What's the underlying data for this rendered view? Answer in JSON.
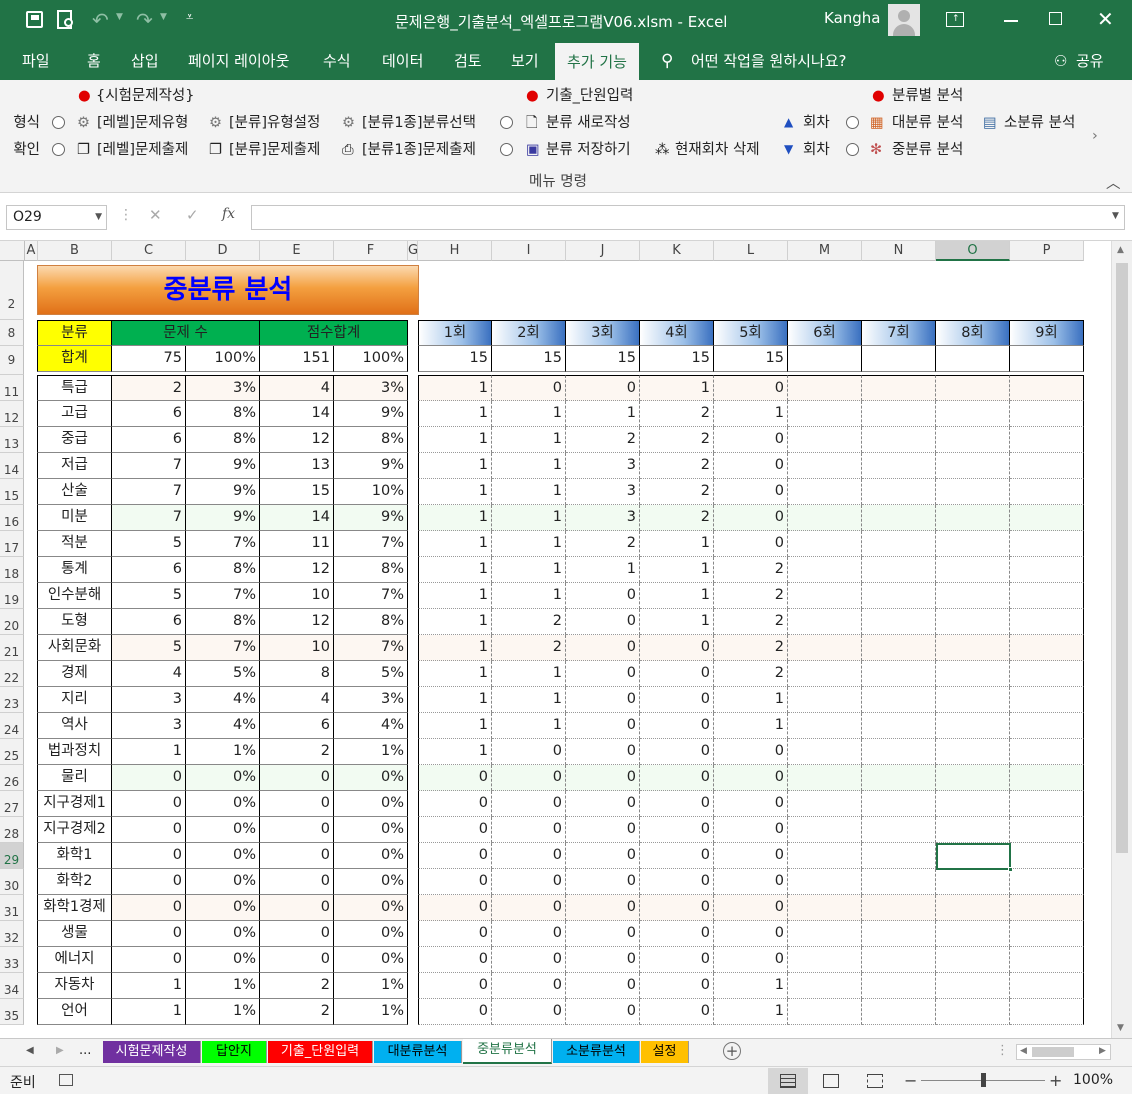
{
  "window": {
    "title": "문제은행_기출분석_엑셀프로그램V06.xlsm  -  Excel",
    "user": "Kangha"
  },
  "tabs": [
    "파일",
    "홈",
    "삽입",
    "페이지 레이아웃",
    "수식",
    "데이터",
    "검토",
    "보기",
    "추가 기능"
  ],
  "active_tab": "추가 기능",
  "tell_me": "어떤 작업을 원하시나요?",
  "share_label": "공유",
  "ribbon": {
    "group_label": "메뉴 명령",
    "g1_title": "{시험문제작성}",
    "g1_left_1": "형식",
    "g1_left_2": "확인",
    "g1_r1": [
      "[레벨]문제유형",
      "[분류]유형설정",
      "[분류1종]분류선택"
    ],
    "g1_r2": [
      "[레벨]문제출제",
      "[분류]문제출제",
      "[분류1종]문제출제"
    ],
    "g2_title": "기출_단원입력",
    "g2_r1": "분류 새로작성",
    "g2_r2": "분류 저장하기",
    "g2_r2b": "현재회차 삭제",
    "g2_up": "회차",
    "g2_down": "회차",
    "g3_title": "분류별 분석",
    "g3_r1a": "대분류 분석",
    "g3_r1b": "소분류 분석",
    "g3_r2": "중분류 분석"
  },
  "formula_bar": {
    "name_box": "O29",
    "formula": ""
  },
  "columns": [
    "A",
    "B",
    "C",
    "D",
    "E",
    "F",
    "G",
    "H",
    "I",
    "J",
    "K",
    "L",
    "M",
    "N",
    "O",
    "P"
  ],
  "row_numbers": [
    "2",
    "8",
    "9",
    "11",
    "12",
    "13",
    "14",
    "15",
    "16",
    "17",
    "18",
    "19",
    "20",
    "21",
    "22",
    "23",
    "24",
    "25",
    "26",
    "27",
    "28",
    "29",
    "30",
    "31",
    "32",
    "33",
    "34",
    "35"
  ],
  "sheet_title": "중분류 분석",
  "header": {
    "category": "분류",
    "count": "문제 수",
    "score": "점수합계",
    "total": "합계",
    "total_count": "75",
    "total_count_pct": "100%",
    "total_score": "151",
    "total_score_pct": "100%",
    "rounds": [
      "1회",
      "2회",
      "3회",
      "4회",
      "5회",
      "6회",
      "7회",
      "8회",
      "9회"
    ],
    "round_totals": [
      "15",
      "15",
      "15",
      "15",
      "15",
      "",
      "",
      "",
      ""
    ]
  },
  "rows": [
    {
      "name": "특급",
      "cnt": "2",
      "cp": "3%",
      "sc": "4",
      "sp": "3%",
      "r": [
        "1",
        "0",
        "0",
        "1",
        "0"
      ]
    },
    {
      "name": "고급",
      "cnt": "6",
      "cp": "8%",
      "sc": "14",
      "sp": "9%",
      "r": [
        "1",
        "1",
        "1",
        "2",
        "1"
      ]
    },
    {
      "name": "중급",
      "cnt": "6",
      "cp": "8%",
      "sc": "12",
      "sp": "8%",
      "r": [
        "1",
        "1",
        "2",
        "2",
        "0"
      ]
    },
    {
      "name": "저급",
      "cnt": "7",
      "cp": "9%",
      "sc": "13",
      "sp": "9%",
      "r": [
        "1",
        "1",
        "3",
        "2",
        "0"
      ]
    },
    {
      "name": "산술",
      "cnt": "7",
      "cp": "9%",
      "sc": "15",
      "sp": "10%",
      "r": [
        "1",
        "1",
        "3",
        "2",
        "0"
      ]
    },
    {
      "name": "미분",
      "cnt": "7",
      "cp": "9%",
      "sc": "14",
      "sp": "9%",
      "r": [
        "1",
        "1",
        "3",
        "2",
        "0"
      ]
    },
    {
      "name": "적분",
      "cnt": "5",
      "cp": "7%",
      "sc": "11",
      "sp": "7%",
      "r": [
        "1",
        "1",
        "2",
        "1",
        "0"
      ]
    },
    {
      "name": "통계",
      "cnt": "6",
      "cp": "8%",
      "sc": "12",
      "sp": "8%",
      "r": [
        "1",
        "1",
        "1",
        "1",
        "2"
      ]
    },
    {
      "name": "인수분해",
      "cnt": "5",
      "cp": "7%",
      "sc": "10",
      "sp": "7%",
      "r": [
        "1",
        "1",
        "0",
        "1",
        "2"
      ]
    },
    {
      "name": "도형",
      "cnt": "6",
      "cp": "8%",
      "sc": "12",
      "sp": "8%",
      "r": [
        "1",
        "2",
        "0",
        "1",
        "2"
      ]
    },
    {
      "name": "사회문화",
      "cnt": "5",
      "cp": "7%",
      "sc": "10",
      "sp": "7%",
      "r": [
        "1",
        "2",
        "0",
        "0",
        "2"
      ]
    },
    {
      "name": "경제",
      "cnt": "4",
      "cp": "5%",
      "sc": "8",
      "sp": "5%",
      "r": [
        "1",
        "1",
        "0",
        "0",
        "2"
      ]
    },
    {
      "name": "지리",
      "cnt": "3",
      "cp": "4%",
      "sc": "4",
      "sp": "3%",
      "r": [
        "1",
        "1",
        "0",
        "0",
        "1"
      ]
    },
    {
      "name": "역사",
      "cnt": "3",
      "cp": "4%",
      "sc": "6",
      "sp": "4%",
      "r": [
        "1",
        "1",
        "0",
        "0",
        "1"
      ]
    },
    {
      "name": "법과정치",
      "cnt": "1",
      "cp": "1%",
      "sc": "2",
      "sp": "1%",
      "r": [
        "1",
        "0",
        "0",
        "0",
        "0"
      ]
    },
    {
      "name": "물리",
      "cnt": "0",
      "cp": "0%",
      "sc": "0",
      "sp": "0%",
      "r": [
        "0",
        "0",
        "0",
        "0",
        "0"
      ]
    },
    {
      "name": "지구경제1",
      "cnt": "0",
      "cp": "0%",
      "sc": "0",
      "sp": "0%",
      "r": [
        "0",
        "0",
        "0",
        "0",
        "0"
      ]
    },
    {
      "name": "지구경제2",
      "cnt": "0",
      "cp": "0%",
      "sc": "0",
      "sp": "0%",
      "r": [
        "0",
        "0",
        "0",
        "0",
        "0"
      ]
    },
    {
      "name": "화학1",
      "cnt": "0",
      "cp": "0%",
      "sc": "0",
      "sp": "0%",
      "r": [
        "0",
        "0",
        "0",
        "0",
        "0"
      ]
    },
    {
      "name": "화학2",
      "cnt": "0",
      "cp": "0%",
      "sc": "0",
      "sp": "0%",
      "r": [
        "0",
        "0",
        "0",
        "0",
        "0"
      ]
    },
    {
      "name": "화학1경제",
      "cnt": "0",
      "cp": "0%",
      "sc": "0",
      "sp": "0%",
      "r": [
        "0",
        "0",
        "0",
        "0",
        "0"
      ]
    },
    {
      "name": "생물",
      "cnt": "0",
      "cp": "0%",
      "sc": "0",
      "sp": "0%",
      "r": [
        "0",
        "0",
        "0",
        "0",
        "0"
      ]
    },
    {
      "name": "에너지",
      "cnt": "0",
      "cp": "0%",
      "sc": "0",
      "sp": "0%",
      "r": [
        "0",
        "0",
        "0",
        "0",
        "0"
      ]
    },
    {
      "name": "자동차",
      "cnt": "1",
      "cp": "1%",
      "sc": "2",
      "sp": "1%",
      "r": [
        "0",
        "0",
        "0",
        "0",
        "1"
      ]
    },
    {
      "name": "언어",
      "cnt": "1",
      "cp": "1%",
      "sc": "2",
      "sp": "1%",
      "r": [
        "0",
        "0",
        "0",
        "0",
        "1"
      ]
    }
  ],
  "sheet_tabs": [
    {
      "label": "시험문제작성",
      "color": "#7030a0",
      "text": "#ffffff"
    },
    {
      "label": "답안지",
      "color": "#00ff00",
      "text": "#000000"
    },
    {
      "label": "기출_단원입력",
      "color": "#ff0000",
      "text": "#ffffff"
    },
    {
      "label": "대분류분석",
      "color": "#00b0f0",
      "text": "#000000"
    },
    {
      "label": "중분류분석",
      "color": "#ffffff",
      "text": "#217346"
    },
    {
      "label": "소분류분석",
      "color": "#00b0f0",
      "text": "#000000"
    },
    {
      "label": "설정",
      "color": "#ffc000",
      "text": "#000000"
    }
  ],
  "sheet_nav_more": "...",
  "status": {
    "ready": "준비",
    "zoom": "100%"
  },
  "colors": {
    "excel_green": "#217346",
    "yellow": "#ffff00",
    "header_green": "#00b050",
    "title_orange": "#f4a040",
    "title_blue": "#0000ff"
  }
}
